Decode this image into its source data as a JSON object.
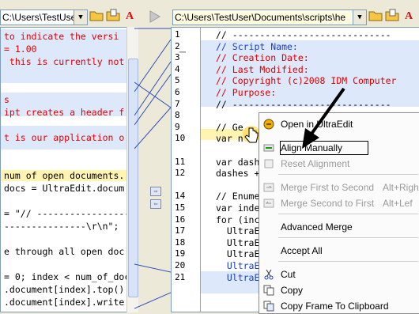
{
  "left_path": "C:\\Users\\TestUser\\Documents\\scripts\\he",
  "right_path": "C:\\Users\\TestUser\\Documents\\scripts\\he",
  "left_lines": [
    {
      "text": "to indicate the versi",
      "cls": "red"
    },
    {
      "text": "= 1.00",
      "cls": "red"
    },
    {
      "text": " this is currently not",
      "cls": "red"
    },
    {
      "text": "",
      "cls": ""
    },
    {
      "text": "",
      "cls": ""
    },
    {
      "text": "s",
      "cls": "red"
    },
    {
      "text": "ipt creates a header f",
      "cls": "red"
    },
    {
      "text": "",
      "cls": ""
    },
    {
      "text": "t is our application o",
      "cls": "red"
    },
    {
      "text": "",
      "cls": ""
    },
    {
      "text": "",
      "cls": ""
    },
    {
      "text": "num of open documents.",
      "cls": ""
    },
    {
      "text": "docs = UltraEdit.docum",
      "cls": ""
    },
    {
      "text": "",
      "cls": ""
    },
    {
      "text": "= \"// ------------------",
      "cls": ""
    },
    {
      "text": "---------------\\r\\n\";",
      "cls": ""
    },
    {
      "text": "",
      "cls": ""
    },
    {
      "text": "e through all open doc",
      "cls": ""
    },
    {
      "text": "",
      "cls": ""
    },
    {
      "text": "= 0; index < num_of_doc",
      "cls": ""
    },
    {
      "text": ".document[index].top()",
      "cls": ""
    },
    {
      "text": ".document[index].write",
      "cls": ""
    }
  ],
  "right_lines": [
    {
      "num": "1",
      "text": "// -----------------------------",
      "cls": ""
    },
    {
      "num": "2",
      "text": "// Script Name:",
      "cls": "blue"
    },
    {
      "num": "3",
      "text": "// Creation Date:",
      "cls": "red"
    },
    {
      "num": "4",
      "text": "// Last Modified:",
      "cls": "red"
    },
    {
      "num": "5",
      "text": "// Copyright (c)2008 IDM Computer",
      "cls": "red"
    },
    {
      "num": "6",
      "text": "// Purpose:",
      "cls": "red"
    },
    {
      "num": "7",
      "text": "// -----------------------------",
      "cls": ""
    },
    {
      "num": "8",
      "text": "",
      "cls": ""
    },
    {
      "num": "9",
      "text": "// Ge",
      "cls": ""
    },
    {
      "num": "10",
      "text": "var n",
      "cls": ""
    },
    {
      "num": "",
      "text": "",
      "cls": ""
    },
    {
      "num": "11",
      "text": "var dash",
      "cls": ""
    },
    {
      "num": "12",
      "text": "dashes +",
      "cls": ""
    },
    {
      "num": "",
      "text": "",
      "cls": ""
    },
    {
      "num": "14",
      "text": "// Enume",
      "cls": ""
    },
    {
      "num": "15",
      "text": "var inde",
      "cls": ""
    },
    {
      "num": "16",
      "text": "for (inc",
      "cls": ""
    },
    {
      "num": "17",
      "text": "  UltraE",
      "cls": ""
    },
    {
      "num": "18",
      "text": "  UltraE",
      "cls": ""
    },
    {
      "num": "19",
      "text": "  UltraE",
      "cls": ""
    },
    {
      "num": "20",
      "text": "  UltraE",
      "cls": "blue"
    },
    {
      "num": "21",
      "text": "  UltraE",
      "cls": "blue"
    }
  ],
  "menu": {
    "open_in": "Open in UltraEdit",
    "align_manually": "Align Manually",
    "reset_alignment": "Reset Alignment",
    "merge_first": "Merge First to Second",
    "merge_first_sc": "Alt+Righ",
    "merge_second": "Merge Second to First",
    "merge_second_sc": "Alt+Lef",
    "advanced_merge": "Advanced Merge",
    "accept_all": "Accept All",
    "cut": "Cut",
    "copy": "Copy",
    "copy_frame": "Copy Frame To Clipboard"
  }
}
